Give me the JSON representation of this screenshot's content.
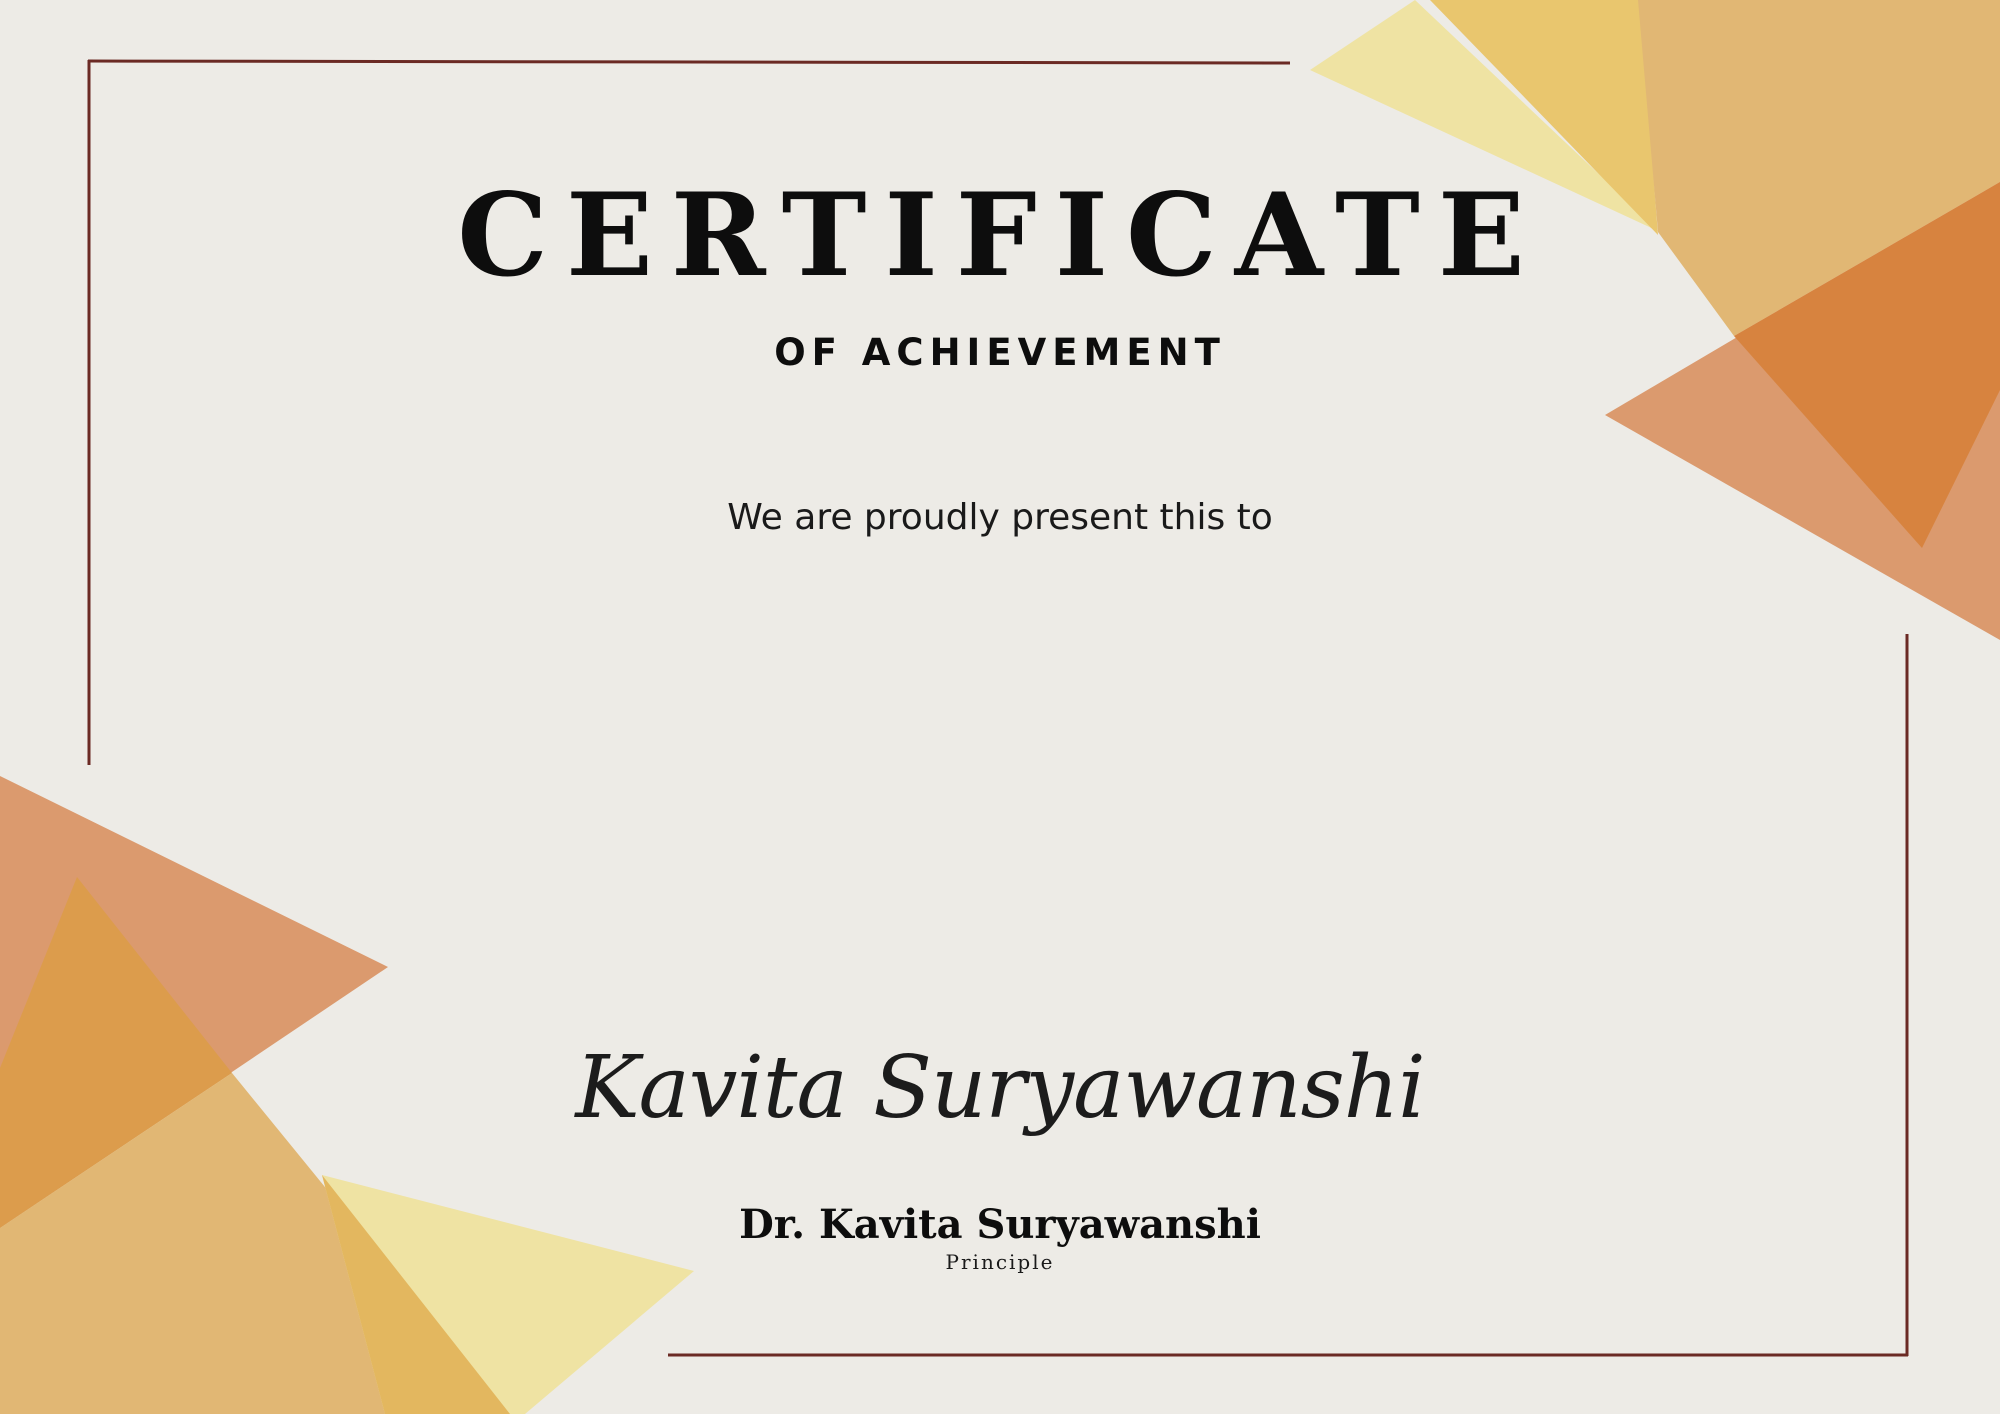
{
  "certificate": {
    "title": "CERTIFICATE",
    "subtitle": "OF ACHIEVEMENT",
    "presentation_text": "We are proudly present this to",
    "signature_script": "Kavita Suryawanshi",
    "signer_name": "Dr. Kavita Suryawanshi",
    "signer_role": "Principle"
  },
  "colors": {
    "background": "#edebe6",
    "border": "#6b2a24",
    "triangle_pale_yellow": "#efe3a3",
    "triangle_gold": "#e9c66e",
    "triangle_sand": "#e1b774",
    "triangle_terracotta": "#db9a6e",
    "triangle_orange": "#d7833f",
    "triangle_amber": "#dc9c4c"
  }
}
